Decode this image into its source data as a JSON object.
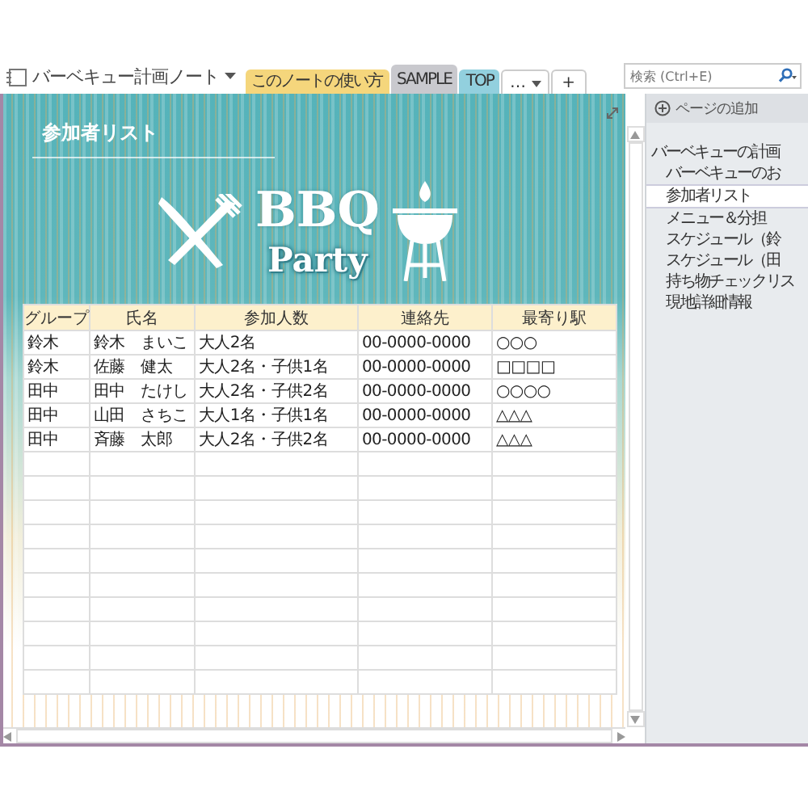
{
  "notebook": {
    "title": "バーベキュー計画ノート"
  },
  "section_tabs": [
    {
      "label": "このノートの使い方",
      "kind": "section",
      "selected": false,
      "color": "#f5d67c"
    },
    {
      "label": "SAMPLE",
      "kind": "section",
      "selected": true,
      "color": "#c9c9ce"
    },
    {
      "label": "TOP",
      "kind": "section",
      "selected": false,
      "color": "#92d0de"
    },
    {
      "label": "…",
      "kind": "more",
      "selected": false
    },
    {
      "label": "+",
      "kind": "add",
      "selected": false
    }
  ],
  "search": {
    "placeholder": "検索 (Ctrl+E)"
  },
  "page": {
    "title": "参加者リスト",
    "logo_line1": "BBQ",
    "logo_line2": "Party"
  },
  "table": {
    "columns": [
      "グループ",
      "氏名",
      "参加人数",
      "連絡先",
      "最寄り駅"
    ],
    "rows": [
      [
        "鈴木",
        "鈴木　まいこ",
        "大人2名",
        "00-0000-0000",
        "○○○"
      ],
      [
        "鈴木",
        "佐藤　健太",
        "大人2名・子供1名",
        "00-0000-0000",
        "□□□□"
      ],
      [
        "田中",
        "田中　たけし",
        "大人2名・子供2名",
        "00-0000-0000",
        "○○○○"
      ],
      [
        "田中",
        "山田　さちこ",
        "大人1名・子供1名",
        "00-0000-0000",
        "△△△"
      ],
      [
        "田中",
        "斉藤　太郎",
        "大人2名・子供2名",
        "00-0000-0000",
        "△△△"
      ]
    ]
  },
  "pages_panel": {
    "add_button": "ページの追加",
    "pages": [
      {
        "label": "バーベキューの計画",
        "selected": false,
        "children": [
          {
            "label": "バーベキューのお",
            "selected": false
          },
          {
            "label": "参加者リスト",
            "selected": true
          },
          {
            "label": "メニュー＆分担",
            "selected": false
          },
          {
            "label": "スケジュール（鈴",
            "selected": false
          },
          {
            "label": "スケジュール（田",
            "selected": false
          },
          {
            "label": "持ち物チェックリス",
            "selected": false
          },
          {
            "label": "現地詳細情報",
            "selected": false
          }
        ]
      }
    ]
  }
}
